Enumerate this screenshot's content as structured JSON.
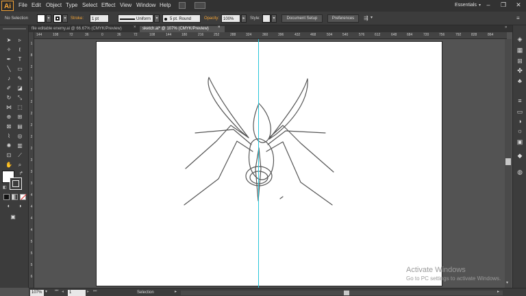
{
  "app": {
    "logo": "Ai",
    "workspace": "Essentials"
  },
  "menu": [
    "File",
    "Edit",
    "Object",
    "Type",
    "Select",
    "Effect",
    "View",
    "Window",
    "Help"
  ],
  "control": {
    "selection_label": "No Selection",
    "stroke_label": "Stroke:",
    "stroke_weight": "1 pt",
    "stroke_profile": "Uniform",
    "brush": "5 pt. Round",
    "opacity_label": "Opacity:",
    "opacity_value": "100%",
    "style_label": "Style:",
    "doc_setup": "Document Setup",
    "preferences": "Preferences"
  },
  "tabs": [
    {
      "label": "file editable enemy.ai @ 66.67% (CMYK/Preview)",
      "close": "×"
    },
    {
      "label": "sketch.ai* @ 107% (CMYK/Preview)",
      "close": "×"
    }
  ],
  "ruler_h": [
    "144",
    "108",
    "72",
    "36",
    "0",
    "36",
    "72",
    "108",
    "144",
    "180",
    "216",
    "252",
    "288",
    "324",
    "360",
    "396",
    "432",
    "468",
    "504",
    "540",
    "576",
    "612",
    "648",
    "684",
    "720",
    "756",
    "792",
    "828",
    "864"
  ],
  "ruler_v": [
    "1",
    "8",
    "2",
    "1",
    "2",
    "2",
    "2",
    "2",
    "2",
    "2",
    "3",
    "3",
    "3",
    "4",
    "4",
    "4",
    "4",
    "5",
    "5",
    "5",
    "6"
  ],
  "status": {
    "zoom": "107%",
    "page": "1",
    "tool": "Selection"
  },
  "watermark": {
    "title": "Activate Windows",
    "subtitle": "Go to PC settings to activate Windows."
  },
  "colors": {
    "accent": "#f7a637",
    "guide": "#27c4d8",
    "sketch": "#555555"
  }
}
